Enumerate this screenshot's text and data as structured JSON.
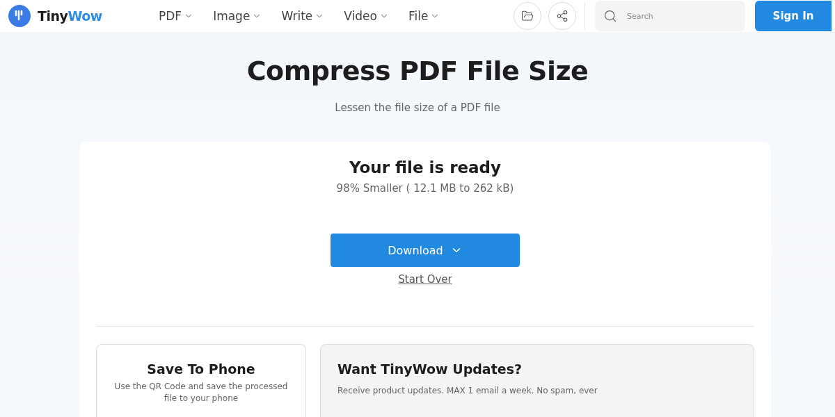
{
  "header": {
    "brand": [
      "Tiny",
      "Wow"
    ],
    "nav": [
      {
        "label": "PDF"
      },
      {
        "label": "Image"
      },
      {
        "label": "Write"
      },
      {
        "label": "Video"
      },
      {
        "label": "File"
      }
    ],
    "search": {
      "placeholder": "Search"
    },
    "sign_in": "Sign In"
  },
  "hero": {
    "title": "Compress PDF File Size",
    "subtitle": "Lessen the file size of a PDF file"
  },
  "result": {
    "title": "Your file is ready",
    "summary": "98% Smaller ( 12.1 MB to 262 kB)",
    "download": "Download",
    "start_over": "Start Over"
  },
  "save_to_phone": {
    "title": "Save To Phone",
    "text": "Use the QR Code and save the processed file to your phone"
  },
  "updates": {
    "title": "Want TinyWow Updates?",
    "text": "Receive product updates. MAX 1 email a week. No spam, ever"
  }
}
